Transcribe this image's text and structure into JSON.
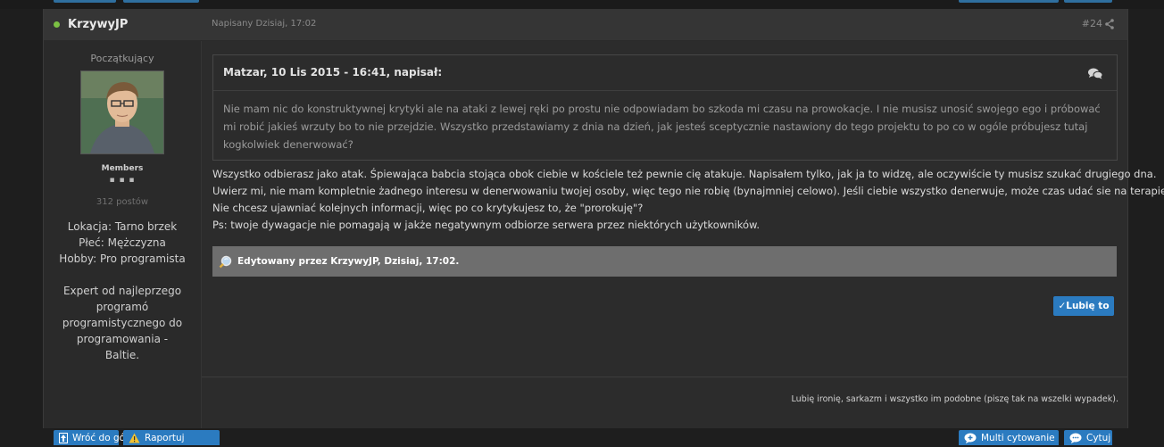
{
  "post": {
    "author": "KrzywyJP",
    "date": "Napisany Dzisiaj, 17:02",
    "number": "#24"
  },
  "author_panel": {
    "rank": "Początkujący",
    "group": "Members",
    "pips": "▪ ▪ ▪",
    "post_count": "312 postów",
    "location": "Lokacja: Tarno brzek",
    "gender": "Płeć: Mężczyzna",
    "hobby": "Hobby: Pro programista",
    "bio": "Expert od najleprzego programó programistycznego do programowania - Baltie."
  },
  "quote": {
    "citation": "Matzar, 10 Lis 2015 - 16:41, napisał:",
    "text": "Nie mam nic do konstruktywnej krytyki ale na ataki z lewej ręki po prostu nie odpowiadam bo szkoda mi czasu na prowokacje. I nie musisz unosić swojego ego i próbować mi robić jakieś wrzuty bo to nie przejdzie. Wszystko przedstawiamy z dnia na dzień, jak jesteś sceptycznie nastawiony do tego projektu to po co w ogóle próbujesz tutaj kogkolwiek denerwować?"
  },
  "body": {
    "line1": "Wszystko odbierasz jako atak. Śpiewająca babcia stojąca obok ciebie w kościele też pewnie cię atakuje. Napisałem tylko, jak ja to widzę, ale oczywiście ty musisz szukać drugiego dna.",
    "line2": "Uwierz mi, nie mam kompletnie żadnego interesu w denerwowaniu twojej osoby, więc tego nie robię (bynajmniej celowo). Jeśli ciebie wszystko denerwuje, może czas udać sie na terapię?",
    "line3": "Nie chcesz ujawniać kolejnych informacji, więc po co krytykujesz to, że \"prorokuję\"?",
    "line4": "Ps: twoje dywagacje nie pomagają w jakże negatywnym odbiorze serwera przez niektórych użytkowników."
  },
  "edit_note": "Edytowany przez KrzywyJP, Dzisiaj, 17:02.",
  "like_label": "✓Lubię to",
  "signature": "Lubię ironię, sarkazm i wszystko im podobne (piszę tak na wszelki wypadek).",
  "bottom_bar": {
    "back_to_top": "Wróć do góry",
    "report": "Raportuj",
    "multi_quote": "Multi cytowanie",
    "quote": "Cytuj"
  },
  "colors": {
    "button_blue": "#2b7bc0",
    "online_green": "#7bc043",
    "edit_bar": "#6e6e6e"
  },
  "icons": [
    "share-icon",
    "quote-bubbles-icon",
    "edit-magnifier-icon",
    "arrow-up-icon",
    "warning-icon",
    "multi-quote-icon",
    "quote-icon"
  ]
}
